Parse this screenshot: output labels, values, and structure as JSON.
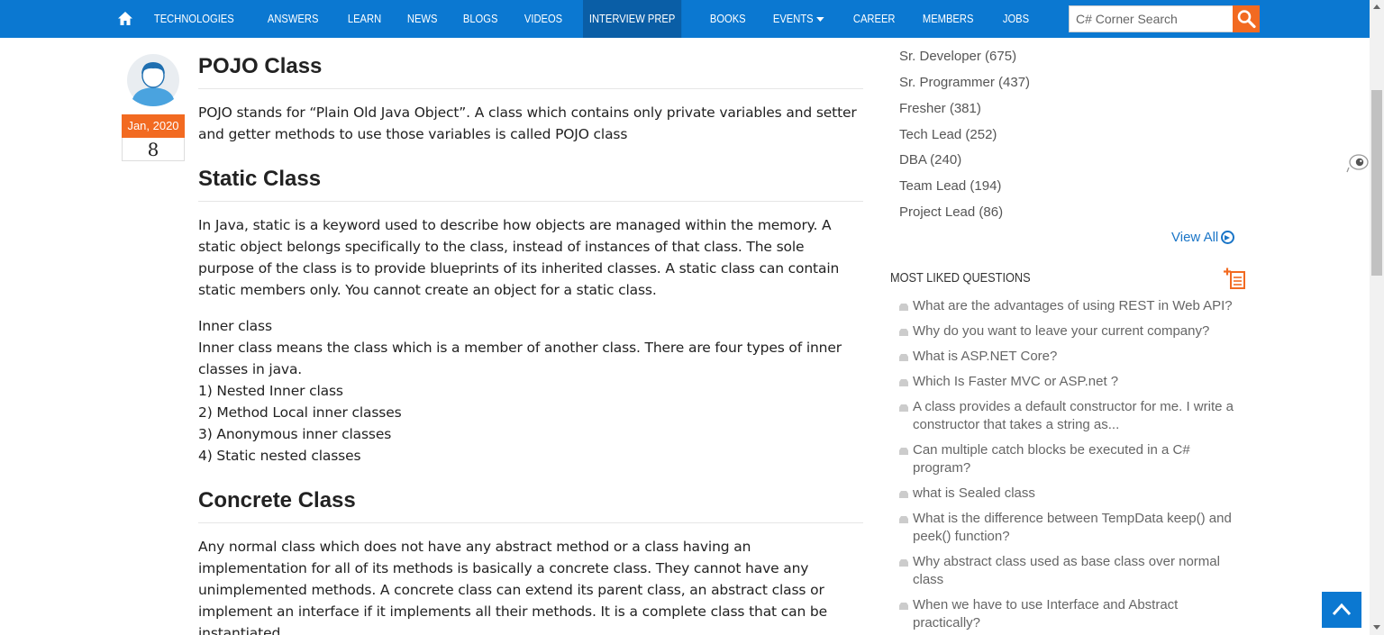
{
  "nav": {
    "items": [
      {
        "label": "TECHNOLOGIES"
      },
      {
        "label": "ANSWERS"
      },
      {
        "label": "LEARN"
      },
      {
        "label": "NEWS"
      },
      {
        "label": "BLOGS"
      },
      {
        "label": "VIDEOS"
      },
      {
        "label": "INTERVIEW PREP",
        "active": true
      },
      {
        "label": "BOOKS"
      },
      {
        "label": "EVENTS",
        "dropdown": true
      },
      {
        "label": "CAREER"
      },
      {
        "label": "MEMBERS"
      },
      {
        "label": "JOBS"
      }
    ],
    "search_placeholder": "C# Corner Search",
    "colors": {
      "bar": "#0b78d1",
      "active": "#0a5ea6",
      "search_button": "#f26a21"
    }
  },
  "post": {
    "date": "Jan, 2020",
    "count": "8"
  },
  "article": {
    "pojo_title": "POJO Class",
    "pojo_text": "POJO stands for “Plain Old Java Object”. A class which contains only private variables and setter and getter methods to use those variables is called POJO class",
    "static_title": "Static Class",
    "static_text": "In Java, static is a keyword used to describe how objects are managed within the memory. A static object belongs specifically to the class, instead of instances of that class. The sole purpose of the class is to provide blueprints of its inherited classes. A static class can contain static members only. You cannot create an object for a static class.",
    "inner_heading": "Inner class",
    "inner_text": "Inner class means the class which is a member of another class. There are four types of inner classes in java.",
    "inner_types": [
      "1) Nested Inner class",
      "2) Method Local inner classes",
      "3) Anonymous inner classes",
      "4) Static nested classes"
    ],
    "concrete_title": "Concrete Class",
    "concrete_text": "Any normal class which does not have any abstract method or a class having an implementation for all of its methods is basically a concrete class. They cannot have any unimplemented methods. A concrete class can extend its parent class, an abstract class or implement an interface if it implements all their methods. It is a complete class that can be instantiated."
  },
  "sidebar": {
    "roles": [
      "Sr. Developer (675)",
      "Sr. Programmer (437)",
      "Fresher (381)",
      "Tech Lead (252)",
      "DBA (240)",
      "Team Lead (194)",
      "Project Lead (86)"
    ],
    "view_all": "View All",
    "most_liked_title": "MOST LIKED QUESTIONS",
    "questions": [
      "What are the advantages of using REST in Web API?",
      "Why do you want to leave your current company?",
      "What is ASP.NET Core?",
      "Which Is Faster MVC or ASP.net ?",
      "A class provides a default constructor for me. I write a constructor that takes a string as...",
      "Can multiple catch blocks be executed in a C# program?",
      "what is Sealed class",
      "What is the difference between TempData keep() and peek() function?",
      "Why abstract class used as base class over normal class",
      "When we have to use Interface and Abstract practically?"
    ],
    "colors": {
      "link": "#1a75c7",
      "accent": "#f26a21"
    }
  }
}
